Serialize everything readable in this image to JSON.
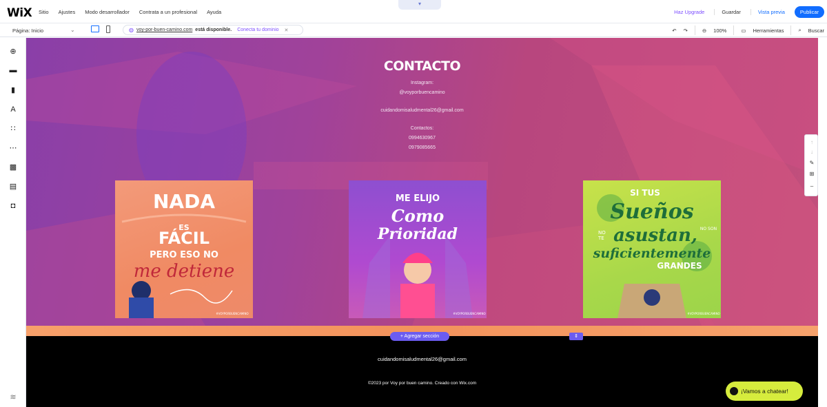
{
  "app": {
    "logo": "WiX"
  },
  "topbar": {
    "menu": [
      "Sitio",
      "Ajustes",
      "Modo desarrollador",
      "Contrata a un profesional",
      "Ayuda"
    ],
    "center_tab": "▾",
    "upgrade": "Haz Upgrade",
    "save": "Guardar",
    "preview": "Vista previa",
    "publish": "Publicar"
  },
  "subbar": {
    "page": "Página: Inicio",
    "domain_url": "voy-por-buen-camino.com",
    "domain_status": "está disponible.",
    "domain_link": "Conecta tu dominio",
    "zoom": "100%",
    "tools": "Herramientas",
    "search": "Buscar"
  },
  "contact": {
    "title": "CONTACTO",
    "instagram_label": "Instagram:",
    "instagram_handle": "@voyporbuencamino",
    "email": "cuidandomisaludmental26@gmail.com",
    "contacts_label": "Contactos:",
    "phone1": "0994630967",
    "phone2": "0979085665"
  },
  "cards": [
    {
      "lines": [
        "NADA",
        "ES",
        "FÁCIL",
        "PERO ESO NO",
        "me detiene"
      ],
      "tag": "#VOYPORBUENCAMINO"
    },
    {
      "lines": [
        "ME ELIJO",
        "Como",
        "Prioridad"
      ],
      "tag": "#VOYPORBUENCAMINO"
    },
    {
      "lines": [
        "SI TUS",
        "Sueños",
        "NO",
        "TE",
        "asustan,",
        "NO SON",
        "suficientemente",
        "GRANDES"
      ],
      "tag": "#VOYPORBUENCAMINO"
    }
  ],
  "editor": {
    "add_section": "+ Agregar sección",
    "section_handle": "⇕"
  },
  "footer": {
    "email": "cuidandomisaludmental26@gmail.com",
    "copyright": "©2023 por Voy por buen camino. Creado con Wix.com"
  },
  "chat": {
    "label": "¡Vamos a chatear!"
  },
  "colors": {
    "wix_blue": "#116dff",
    "hero_purple": "#9a3fa0",
    "footer_black": "#000000",
    "chat_green": "#d6ec3d"
  }
}
